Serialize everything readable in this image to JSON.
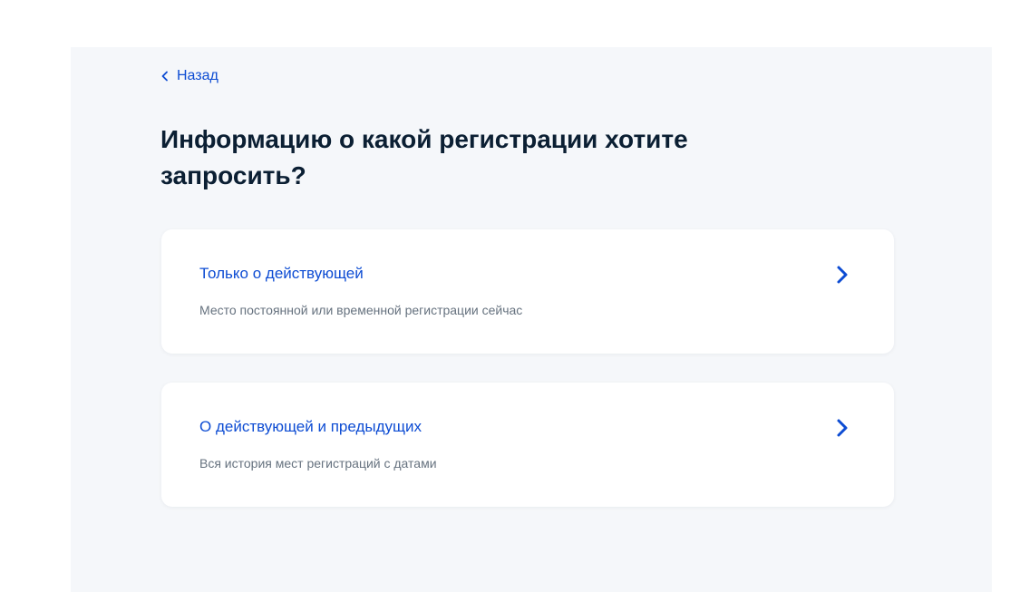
{
  "nav": {
    "back_label": "Назад",
    "back_icon": "chevron-left-icon"
  },
  "page": {
    "title": "Информацию о какой регистрации хотите запросить?"
  },
  "options": [
    {
      "title": "Только о действующей",
      "description": "Место постоянной или временной регистрации сейчас",
      "icon": "chevron-right-icon"
    },
    {
      "title": "О действующей и предыдущих",
      "description": "Вся история мест регистраций с датами",
      "icon": "chevron-right-icon"
    }
  ],
  "colors": {
    "accent": "#0d4cd3",
    "title_text": "#0b1f33",
    "secondary_text": "#66727f",
    "panel_background": "#f5f7fa",
    "card_background": "#ffffff"
  }
}
